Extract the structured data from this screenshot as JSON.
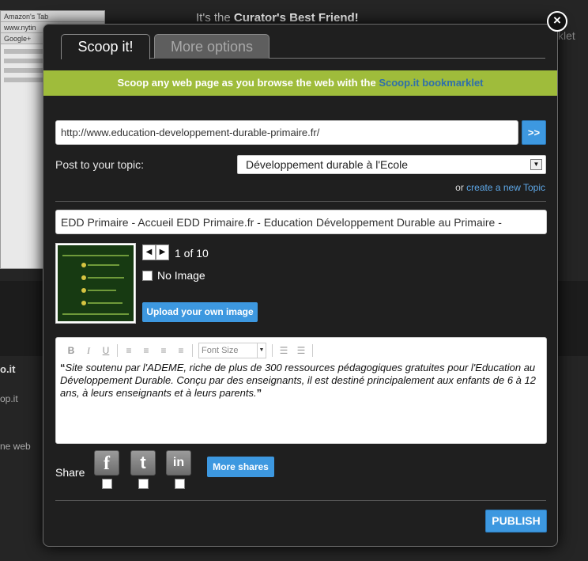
{
  "background": {
    "headline_prefix": "It's the ",
    "headline_bold": "Curator's Best Friend!",
    "right_fragment": "klet",
    "left_fragments": [
      "o.it",
      "op.it",
      "ne web"
    ],
    "shot_tabs": [
      "Amazon's Tab",
      "www.nytin",
      "Google+"
    ]
  },
  "modal": {
    "close_symbol": "×",
    "tabs": [
      {
        "label": "Scoop it!",
        "active": true
      },
      {
        "label": "More options",
        "active": false
      }
    ],
    "banner": {
      "text": "Scoop any web page as you browse the web with the ",
      "link": "Scoop.it bookmarklet"
    },
    "url_input": {
      "value": "http://www.education-developpement-durable-primaire.fr/"
    },
    "go_button": ">>",
    "topic": {
      "label": "Post to your topic:",
      "selected": "Développement durable à l'Ecole",
      "arrow": "▼"
    },
    "create_topic": {
      "prefix": "or ",
      "link": "create a new Topic"
    },
    "title_input": {
      "value": "EDD Primaire - Accueil EDD Primaire.fr - Education Développement Durable au Primaire -"
    },
    "image": {
      "prev": "◀",
      "next": "▶",
      "count": "1 of 10",
      "no_image_label": "No Image",
      "upload_label": "Upload your own image"
    },
    "editor": {
      "toolbar": {
        "bold": "B",
        "italic": "I",
        "underline": "U",
        "align_left": "≡",
        "align_center": "≡",
        "align_right": "≡",
        "justify": "≡",
        "font_size": "Font Size",
        "font_size_arrow": "▼",
        "bullet_list": "☰",
        "numbered_list": "☰"
      },
      "open_quote": "“",
      "text": "Site soutenu par l'ADEME, riche de plus de 300 ressources pédagogiques gratuites pour l'Education au Développement Durable. Conçu par des enseignants, il est destiné principalement aux enfants de 6 à 12 ans, à leurs enseignants et à leurs parents.",
      "close_quote": "”"
    },
    "share": {
      "label": "Share",
      "facebook": "f",
      "twitter": "t",
      "linkedin": "in",
      "more_label": "More shares"
    },
    "publish_label": "PUBLISH"
  },
  "colors": {
    "banner_green": "#9fbc3b",
    "accent_blue": "#3d98e0",
    "link_blue": "#5ea8e8",
    "modal_bg": "#1f1f1f"
  }
}
